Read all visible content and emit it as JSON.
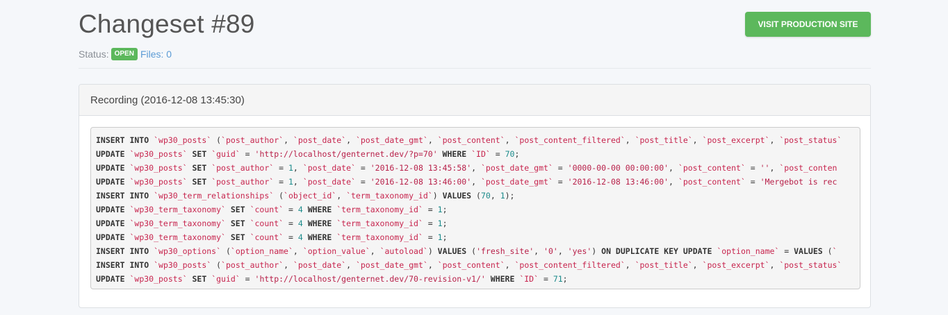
{
  "page": {
    "title": "Changeset #89",
    "visit_button": "VISIT PRODUCTION SITE",
    "status_label": "Status:",
    "status_badge": "OPEN",
    "files_link": "Files: 0"
  },
  "colors": {
    "primary_green": "#5cb85c",
    "link_blue": "#5b9bd5",
    "identifier_red": "#c7254e",
    "number_teal": "#1a8a8a"
  },
  "recording": {
    "heading": "Recording (2016-12-08 13:45:30)",
    "lines": [
      [
        [
          "kw",
          "INSERT INTO "
        ],
        [
          "id",
          "`wp30_posts`"
        ],
        [
          "pn",
          " ("
        ],
        [
          "id",
          "`post_author`"
        ],
        [
          "pn",
          ", "
        ],
        [
          "id",
          "`post_date`"
        ],
        [
          "pn",
          ", "
        ],
        [
          "id",
          "`post_date_gmt`"
        ],
        [
          "pn",
          ", "
        ],
        [
          "id",
          "`post_content`"
        ],
        [
          "pn",
          ", "
        ],
        [
          "id",
          "`post_content_filtered`"
        ],
        [
          "pn",
          ", "
        ],
        [
          "id",
          "`post_title`"
        ],
        [
          "pn",
          ", "
        ],
        [
          "id",
          "`post_excerpt`"
        ],
        [
          "pn",
          ", "
        ],
        [
          "id",
          "`post_status`"
        ]
      ],
      [
        [
          "kw",
          "UPDATE "
        ],
        [
          "id",
          "`wp30_posts`"
        ],
        [
          "kw",
          " SET "
        ],
        [
          "id",
          "`guid`"
        ],
        [
          "pn",
          " = "
        ],
        [
          "str",
          "'http://localhost/genternet.dev/?p=70'"
        ],
        [
          "kw",
          " WHERE "
        ],
        [
          "id",
          "`ID`"
        ],
        [
          "pn",
          " = "
        ],
        [
          "num",
          "70"
        ],
        [
          "pn",
          ";"
        ]
      ],
      [
        [
          "kw",
          "UPDATE "
        ],
        [
          "id",
          "`wp30_posts`"
        ],
        [
          "kw",
          " SET "
        ],
        [
          "id",
          "`post_author`"
        ],
        [
          "pn",
          " = "
        ],
        [
          "num",
          "1"
        ],
        [
          "pn",
          ", "
        ],
        [
          "id",
          "`post_date`"
        ],
        [
          "pn",
          " = "
        ],
        [
          "str",
          "'2016-12-08 13:45:58'"
        ],
        [
          "pn",
          ", "
        ],
        [
          "id",
          "`post_date_gmt`"
        ],
        [
          "pn",
          " = "
        ],
        [
          "str",
          "'0000-00-00 00:00:00'"
        ],
        [
          "pn",
          ", "
        ],
        [
          "id",
          "`post_content`"
        ],
        [
          "pn",
          " = "
        ],
        [
          "str",
          "''"
        ],
        [
          "pn",
          ", "
        ],
        [
          "id",
          "`post_conten"
        ]
      ],
      [
        [
          "kw",
          "UPDATE "
        ],
        [
          "id",
          "`wp30_posts`"
        ],
        [
          "kw",
          " SET "
        ],
        [
          "id",
          "`post_author`"
        ],
        [
          "pn",
          " = "
        ],
        [
          "num",
          "1"
        ],
        [
          "pn",
          ", "
        ],
        [
          "id",
          "`post_date`"
        ],
        [
          "pn",
          " = "
        ],
        [
          "str",
          "'2016-12-08 13:46:00'"
        ],
        [
          "pn",
          ", "
        ],
        [
          "id",
          "`post_date_gmt`"
        ],
        [
          "pn",
          " = "
        ],
        [
          "str",
          "'2016-12-08 13:46:00'"
        ],
        [
          "pn",
          ", "
        ],
        [
          "id",
          "`post_content`"
        ],
        [
          "pn",
          " = "
        ],
        [
          "str",
          "'Mergebot is rec"
        ]
      ],
      [
        [
          "kw",
          "INSERT INTO "
        ],
        [
          "id",
          "`wp30_term_relationships`"
        ],
        [
          "pn",
          " ("
        ],
        [
          "id",
          "`object_id`"
        ],
        [
          "pn",
          ", "
        ],
        [
          "id",
          "`term_taxonomy_id`"
        ],
        [
          "pn",
          ") "
        ],
        [
          "kw",
          "VALUES"
        ],
        [
          "pn",
          " ("
        ],
        [
          "num",
          "70"
        ],
        [
          "pn",
          ", "
        ],
        [
          "num",
          "1"
        ],
        [
          "pn",
          ");"
        ]
      ],
      [
        [
          "kw",
          "UPDATE "
        ],
        [
          "id",
          "`wp30_term_taxonomy`"
        ],
        [
          "kw",
          " SET "
        ],
        [
          "id",
          "`count`"
        ],
        [
          "pn",
          " = "
        ],
        [
          "num",
          "4"
        ],
        [
          "kw",
          " WHERE "
        ],
        [
          "id",
          "`term_taxonomy_id`"
        ],
        [
          "pn",
          " = "
        ],
        [
          "num",
          "1"
        ],
        [
          "pn",
          ";"
        ]
      ],
      [
        [
          "kw",
          "UPDATE "
        ],
        [
          "id",
          "`wp30_term_taxonomy`"
        ],
        [
          "kw",
          " SET "
        ],
        [
          "id",
          "`count`"
        ],
        [
          "pn",
          " = "
        ],
        [
          "num",
          "4"
        ],
        [
          "kw",
          " WHERE "
        ],
        [
          "id",
          "`term_taxonomy_id`"
        ],
        [
          "pn",
          " = "
        ],
        [
          "num",
          "1"
        ],
        [
          "pn",
          ";"
        ]
      ],
      [
        [
          "kw",
          "UPDATE "
        ],
        [
          "id",
          "`wp30_term_taxonomy`"
        ],
        [
          "kw",
          " SET "
        ],
        [
          "id",
          "`count`"
        ],
        [
          "pn",
          " = "
        ],
        [
          "num",
          "4"
        ],
        [
          "kw",
          " WHERE "
        ],
        [
          "id",
          "`term_taxonomy_id`"
        ],
        [
          "pn",
          " = "
        ],
        [
          "num",
          "1"
        ],
        [
          "pn",
          ";"
        ]
      ],
      [
        [
          "kw",
          "INSERT INTO "
        ],
        [
          "id",
          "`wp30_options`"
        ],
        [
          "pn",
          " ("
        ],
        [
          "id",
          "`option_name`"
        ],
        [
          "pn",
          ", "
        ],
        [
          "id",
          "`option_value`"
        ],
        [
          "pn",
          ", "
        ],
        [
          "id",
          "`autoload`"
        ],
        [
          "pn",
          ") "
        ],
        [
          "kw",
          "VALUES"
        ],
        [
          "pn",
          " ("
        ],
        [
          "str",
          "'fresh_site'"
        ],
        [
          "pn",
          ", "
        ],
        [
          "str",
          "'0'"
        ],
        [
          "pn",
          ", "
        ],
        [
          "str",
          "'yes'"
        ],
        [
          "pn",
          ") "
        ],
        [
          "kw",
          "ON DUPLICATE KEY UPDATE "
        ],
        [
          "id",
          "`option_name`"
        ],
        [
          "pn",
          " = "
        ],
        [
          "kw",
          "VALUES"
        ],
        [
          "pn",
          " ("
        ],
        [
          "id",
          "`"
        ]
      ],
      [
        [
          "kw",
          "INSERT INTO "
        ],
        [
          "id",
          "`wp30_posts`"
        ],
        [
          "pn",
          " ("
        ],
        [
          "id",
          "`post_author`"
        ],
        [
          "pn",
          ", "
        ],
        [
          "id",
          "`post_date`"
        ],
        [
          "pn",
          ", "
        ],
        [
          "id",
          "`post_date_gmt`"
        ],
        [
          "pn",
          ", "
        ],
        [
          "id",
          "`post_content`"
        ],
        [
          "pn",
          ", "
        ],
        [
          "id",
          "`post_content_filtered`"
        ],
        [
          "pn",
          ", "
        ],
        [
          "id",
          "`post_title`"
        ],
        [
          "pn",
          ", "
        ],
        [
          "id",
          "`post_excerpt`"
        ],
        [
          "pn",
          ", "
        ],
        [
          "id",
          "`post_status`"
        ]
      ],
      [
        [
          "kw",
          "UPDATE "
        ],
        [
          "id",
          "`wp30_posts`"
        ],
        [
          "kw",
          " SET "
        ],
        [
          "id",
          "`guid`"
        ],
        [
          "pn",
          " = "
        ],
        [
          "str",
          "'http://localhost/genternet.dev/70-revision-v1/'"
        ],
        [
          "kw",
          " WHERE "
        ],
        [
          "id",
          "`ID`"
        ],
        [
          "pn",
          " = "
        ],
        [
          "num",
          "71"
        ],
        [
          "pn",
          ";"
        ]
      ]
    ]
  }
}
